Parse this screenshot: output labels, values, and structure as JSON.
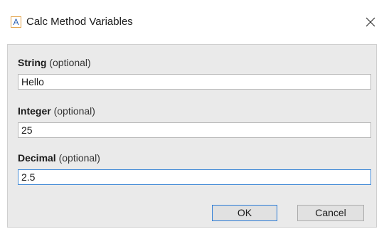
{
  "window": {
    "title": "Calc Method Variables",
    "icon_letter": "A",
    "close_icon": "close-icon"
  },
  "fields": [
    {
      "name": "String",
      "optional": "(optional)",
      "value": "Hello"
    },
    {
      "name": "Integer",
      "optional": "(optional)",
      "value": "25"
    },
    {
      "name": "Decimal",
      "optional": "(optional)",
      "value": "2.5"
    }
  ],
  "buttons": {
    "ok": "OK",
    "cancel": "Cancel"
  },
  "colors": {
    "focus_border": "#4a8fd8",
    "panel_bg": "#eaeaea",
    "icon_border": "#e3a34a",
    "icon_letter": "#2a5fb0"
  }
}
